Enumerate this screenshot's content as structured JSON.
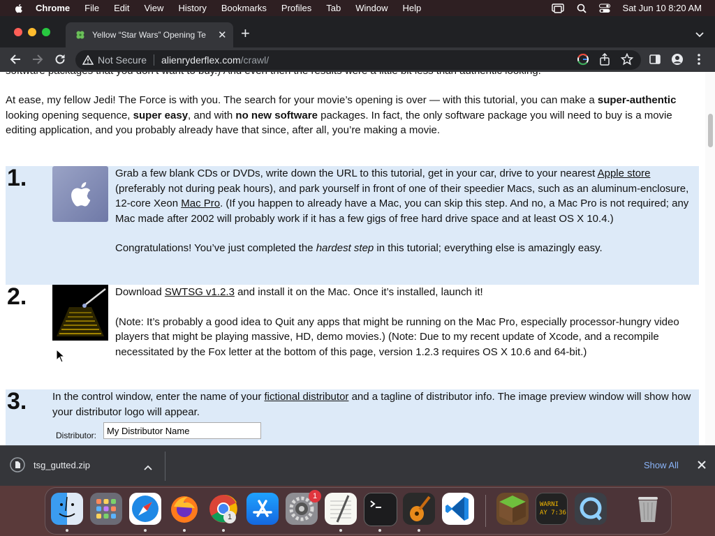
{
  "menubar": {
    "items": [
      "Chrome",
      "File",
      "Edit",
      "View",
      "History",
      "Bookmarks",
      "Profiles",
      "Tab",
      "Window",
      "Help"
    ],
    "clock": "Sat Jun 10  8:20 AM"
  },
  "browser": {
    "tab_title": "Yellow “Star Wars” Opening Te",
    "not_secure": "Not Secure",
    "url_host": "alienryderflex.com",
    "url_path": "/crawl/"
  },
  "page": {
    "cut_text": "software packages that you don’t want to buy.) And even then the results were a little bit less than authentic looking.",
    "intro": [
      {
        "t": "At ease, my fellow Jedi! The Force is with you. The search for your movie’s opening is over — with this tutorial, you can make a "
      },
      {
        "t": "super-authentic",
        "b": true
      },
      {
        "t": " looking opening sequence, "
      },
      {
        "t": "super easy",
        "b": true
      },
      {
        "t": ", and with "
      },
      {
        "t": "no new software",
        "b": true
      },
      {
        "t": " packages. In fact, the only software package you will need to buy is a movie editing application, and you probably already have that since, after all, you’re making a movie."
      }
    ],
    "step1": {
      "num": "1.",
      "p1": [
        {
          "t": "Grab a few blank CDs or DVDs, write down the URL to this tutorial, get in your car, drive to your nearest "
        },
        {
          "t": "Apple store",
          "link": true
        },
        {
          "t": " (preferably not during peak hours), and park yourself in front of one of their speedier Macs, such as an aluminum-enclosure, 12-core Xeon "
        },
        {
          "t": "Mac Pro",
          "link": true
        },
        {
          "t": ". (If you happen to already have a Mac, you can skip this step. And no, a Mac Pro is not required; any Mac made after 2002 will probably work if it has a few gigs of free hard drive space and at least OS X 10.4.)"
        }
      ],
      "p2": [
        {
          "t": "Congratulations! You’ve just completed the "
        },
        {
          "t": "hardest step",
          "i": true
        },
        {
          "t": " in this tutorial; everything else is amazingly easy."
        }
      ]
    },
    "step2": {
      "num": "2.",
      "p1": [
        {
          "t": "Download "
        },
        {
          "t": "SWTSG v1.2.3",
          "link": true
        },
        {
          "t": " and install it on the Mac. Once it’s installed, launch it!"
        }
      ],
      "p2": [
        {
          "t": "(Note: It’s probably a good idea to Quit any apps that might be running on the Mac Pro, especially processor-hungry video players that might be playing massive, HD, demo movies.) (Note: Due to my recent update of Xcode, and a recompile necessitated by the Fox letter at the bottom of this page, version 1.2.3 requires OS X 10.6 and 64-bit.)"
        }
      ]
    },
    "step3": {
      "num": "3.",
      "p1": [
        {
          "t": "In the control window, enter the name of your "
        },
        {
          "t": "fictional distributor",
          "link": true
        },
        {
          "t": " and a tagline of distributor info. The image preview window will show how your distributor logo will appear."
        }
      ],
      "distributor_label": "Distributor:",
      "distributor_value": "My Distributor Name"
    }
  },
  "downloads": {
    "filename": "tsg_gutted.zip",
    "show_all": "Show All"
  },
  "dock": {
    "settings_badge": "1",
    "chrome_badge": "1",
    "warning_text": "WARNI\nAY 7:36"
  },
  "colors": {
    "step_bg": "#ddeaf8",
    "link_blue": "#8ab4f8"
  }
}
